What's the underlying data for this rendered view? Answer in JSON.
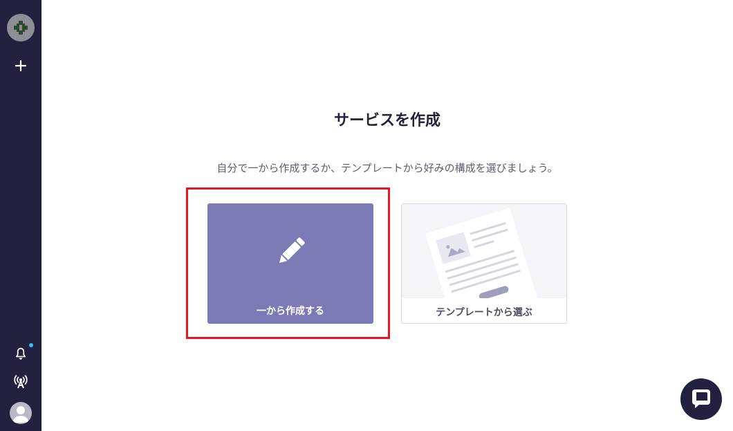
{
  "sidebar": {
    "logo_icon": "puzzle-icon",
    "add_icon": "plus-icon",
    "notification_icon": "bell-icon",
    "notification_dot_color": "#2ec1f2",
    "broadcast_icon": "antenna-icon",
    "avatar_icon": "user-icon",
    "background_color": "#222240"
  },
  "main": {
    "title": "サービスを作成",
    "subtitle": "自分で一から作成するか、テンプレートから好みの構成を選びましょう。",
    "options": [
      {
        "label": "一から作成する",
        "icon": "pencil-icon",
        "color": "#7b7ab5",
        "highlighted": true
      },
      {
        "label": "テンプレートから選ぶ",
        "icon": "template-document-icon",
        "highlighted": false
      }
    ],
    "highlight_color": "#e3191f"
  },
  "chat": {
    "icon": "chat-bubble-icon"
  }
}
